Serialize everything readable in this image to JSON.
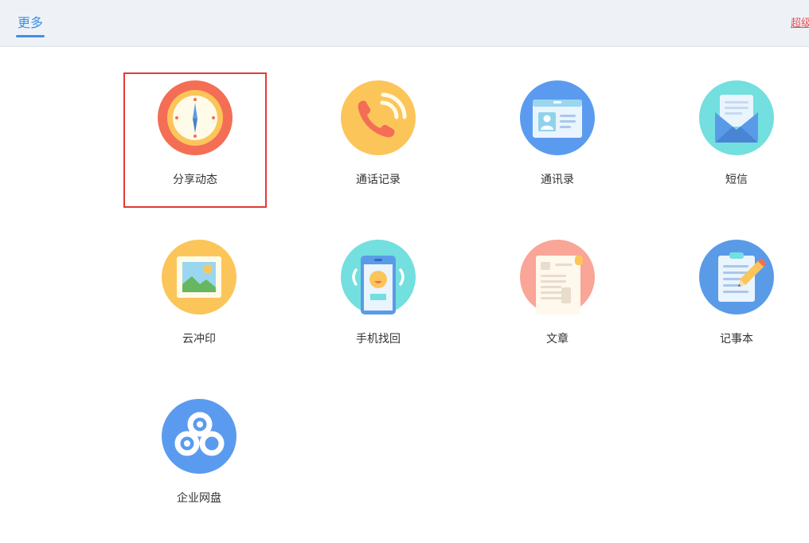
{
  "header": {
    "tab_label": "更多",
    "right_link": "超级"
  },
  "colors": {
    "accent": "#3d8fe8",
    "selection_border": "#e53935"
  },
  "apps": [
    {
      "label": "分享动态",
      "icon": "clock-icon",
      "selected": true
    },
    {
      "label": "通话记录",
      "icon": "phone-icon"
    },
    {
      "label": "通讯录",
      "icon": "contact-card-icon"
    },
    {
      "label": "短信",
      "icon": "envelope-icon"
    },
    {
      "label": "云冲印",
      "icon": "photo-icon"
    },
    {
      "label": "手机找回",
      "icon": "phone-find-icon"
    },
    {
      "label": "文章",
      "icon": "document-icon"
    },
    {
      "label": "记事本",
      "icon": "notepad-icon"
    },
    {
      "label": "企业网盘",
      "icon": "cloud-drive-icon"
    }
  ]
}
